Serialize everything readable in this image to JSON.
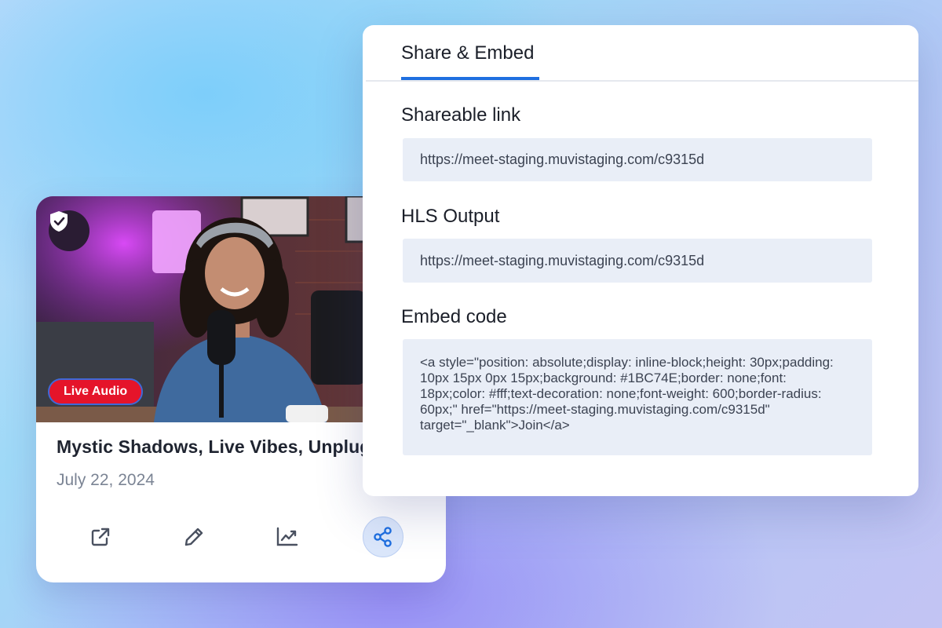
{
  "video_card": {
    "badge": "Live Audio",
    "title": "Mystic Shadows, Live Vibes, Unplugged",
    "date": "July 22, 2024",
    "actions": [
      "open-external",
      "edit",
      "analytics",
      "share"
    ]
  },
  "share_panel": {
    "tab_label": "Share & Embed",
    "shareable_link": {
      "label": "Shareable link",
      "value": "https://meet-staging.muvistaging.com/c9315d"
    },
    "hls_output": {
      "label": "HLS Output",
      "value": "https://meet-staging.muvistaging.com/c9315d"
    },
    "embed_code": {
      "label": "Embed code",
      "value": "<a style=\"position: absolute;display: inline-block;height: 30px;padding: 10px 15px 0px 15px;background: #1BC74E;border: none;font: 18px;color: #fff;text-decoration: none;font-weight: 600;border-radius: 60px;\" href=\"https://meet-staging.muvistaging.com/c9315d\" target=\"_blank\">Join</a>"
    }
  },
  "colors": {
    "accent": "#1f6fe0",
    "live_badge": "#e5142a",
    "field_bg": "#e9eef7"
  }
}
